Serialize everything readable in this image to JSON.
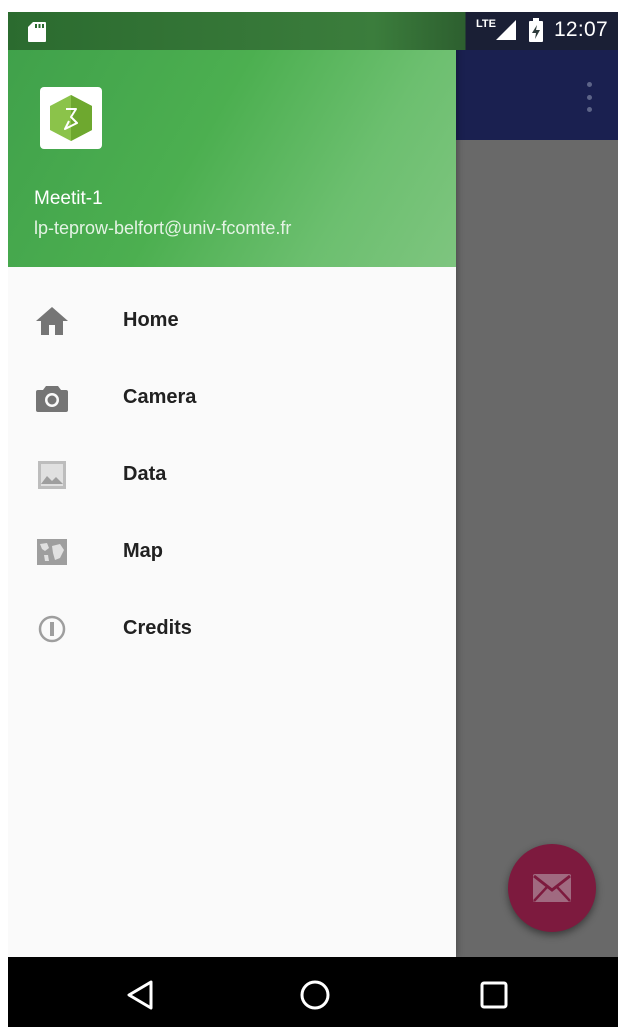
{
  "status_bar": {
    "time": "12:07",
    "network_label": "LTE",
    "icons": [
      "sd-card-icon",
      "signal-icon",
      "battery-icon"
    ]
  },
  "drawer": {
    "header": {
      "account_name": "Meetit-1",
      "account_email": "lp-teprow-belfort@univ-fcomte.fr",
      "logo": "app-logo-icon"
    },
    "items": [
      {
        "label": "Home",
        "icon": "home-icon"
      },
      {
        "label": "Camera",
        "icon": "camera-icon"
      },
      {
        "label": "Data",
        "icon": "image-icon"
      },
      {
        "label": "Map",
        "icon": "map-icon"
      },
      {
        "label": "Credits",
        "icon": "info-icon"
      }
    ]
  },
  "app": {
    "toolbar_color": "#1a2050",
    "fab_icon": "mail-icon",
    "fab_color": "#7d1a3e"
  },
  "nav_bar": {
    "buttons": [
      "back-icon",
      "home-circle-icon",
      "recents-icon"
    ]
  },
  "colors": {
    "header_green": "#4caf50",
    "icon_gray": "#757575"
  }
}
